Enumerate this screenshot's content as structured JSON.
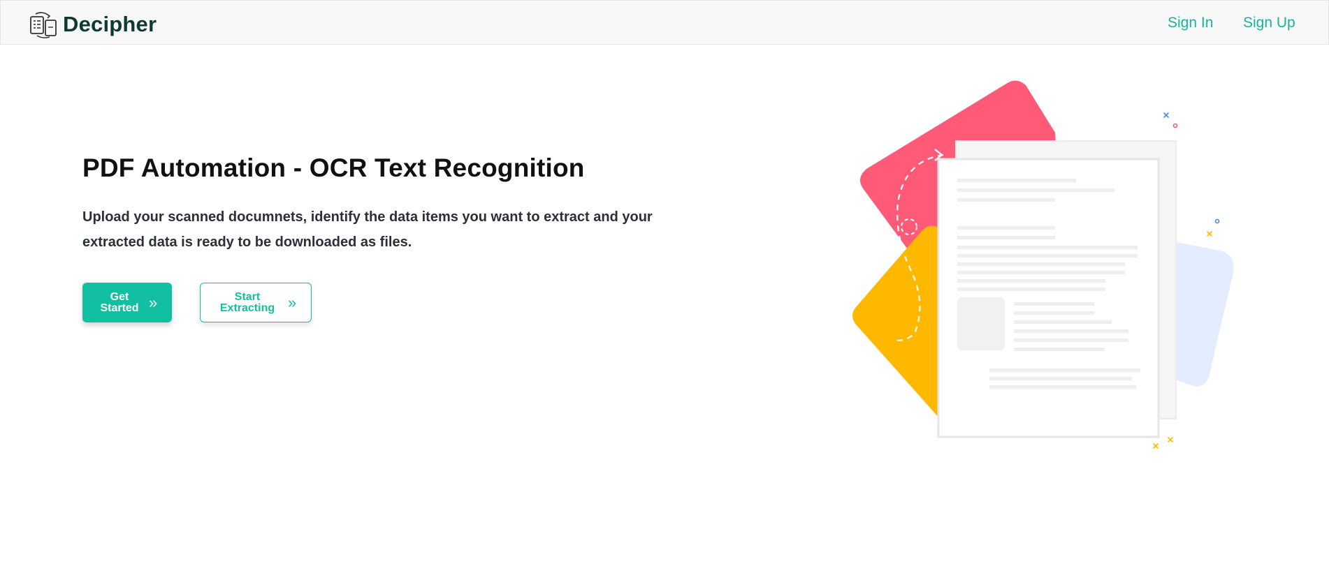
{
  "navbar": {
    "brand_name": "Decipher",
    "brand_icon": "document-convert-icon",
    "links": {
      "sign_in": "Sign In",
      "sign_up": "Sign Up"
    }
  },
  "hero": {
    "title": "PDF Automation - OCR Text Recognition",
    "description": "Upload your scanned documnets, identify the data items you want to extract and your extracted data is ready to be downloaded as files.",
    "buttons": {
      "get_started": "Get Started",
      "get_started_icon": "double-chevron-right-icon",
      "start_extracting": "Start Extracting",
      "start_extracting_icon": "double-chevron-right-icon"
    }
  },
  "colors": {
    "accent": "#12bfa0",
    "brand_text": "#0f3a33",
    "illustration_pink": "#ff5a78",
    "illustration_yellow": "#ffb800",
    "illustration_blue": "#e2ecfd"
  }
}
